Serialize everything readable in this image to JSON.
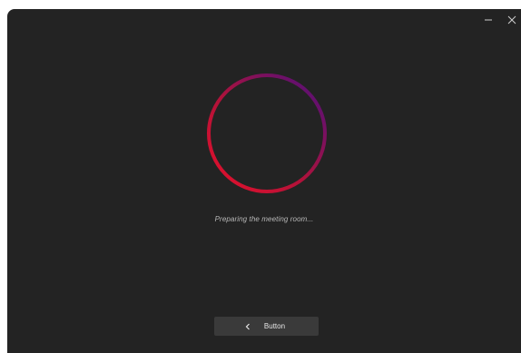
{
  "window": {
    "controls": {
      "minimize_icon": "minimize-icon",
      "close_icon": "close-icon"
    }
  },
  "loader": {
    "status_text": "Preparing the meeting room...",
    "ring_colors": {
      "start": "#e8102a",
      "end": "#4a0f80"
    }
  },
  "footer": {
    "back_button_label": "Button",
    "back_icon": "chevron-left-icon"
  },
  "colors": {
    "window_bg": "#232323",
    "button_bg": "#3a3a3a",
    "text_muted": "#b8b8b8"
  }
}
